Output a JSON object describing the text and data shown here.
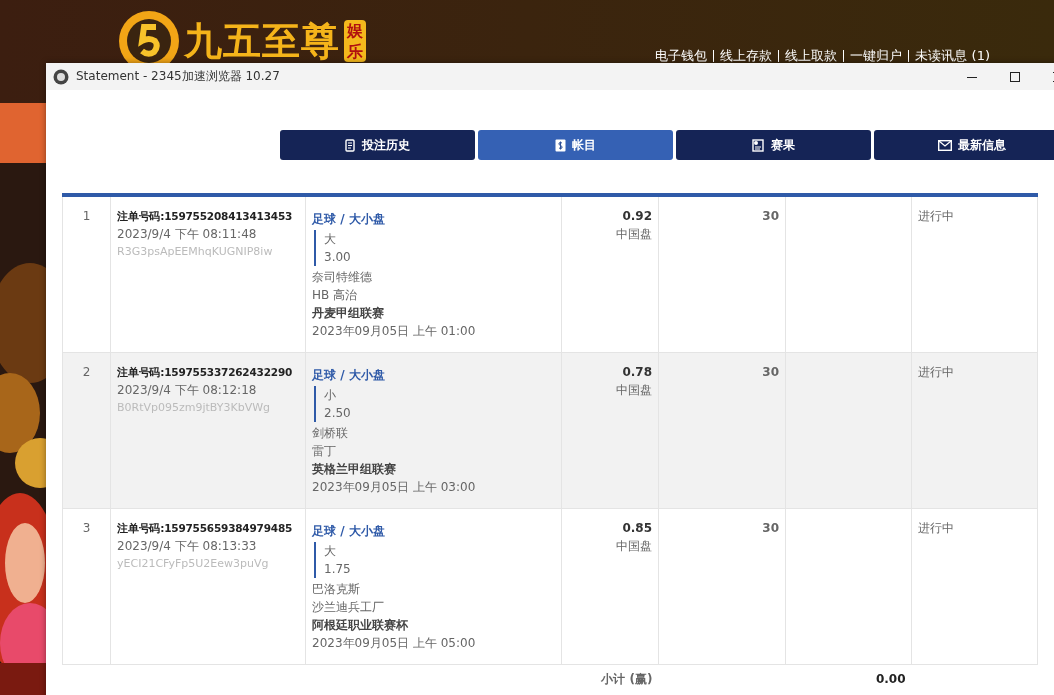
{
  "site": {
    "logo": "九五至尊",
    "logo_badge": "娱乐",
    "links": [
      "电子钱包",
      "线上存款",
      "线上取款",
      "一键归户",
      "未读讯息 (1)"
    ]
  },
  "window": {
    "title": "Statement - 2345加速浏览器 10.27"
  },
  "tabs": [
    {
      "label": "投注历史",
      "selected": false
    },
    {
      "label": "帐目",
      "selected": true
    },
    {
      "label": "赛果",
      "selected": false
    },
    {
      "label": "最新信息",
      "selected": false
    }
  ],
  "rows": [
    {
      "index": "1",
      "bet_no": "注单号码:159755208413413453",
      "time": "2023/9/4 下午 08:11:48",
      "code": "R3G3psApEEMhqKUGNIP8iw",
      "market": "足球 / 大小盘",
      "pick": "大",
      "line": "3.00",
      "home": "奈司特维德",
      "away": "HB 高治",
      "league": "丹麦甲组联赛",
      "match_time": "2023年09月05日 上午 01:00",
      "odds": "0.92",
      "odds_type": "中国盘",
      "stake": "30",
      "status": "进行中"
    },
    {
      "index": "2",
      "bet_no": "注单号码:159755337262432290",
      "time": "2023/9/4 下午 08:12:18",
      "code": "B0RtVp095zm9jtBY3KbVWg",
      "market": "足球 / 大小盘",
      "pick": "小",
      "line": "2.50",
      "home": "剑桥联",
      "away": "雷丁",
      "league": "英格兰甲组联赛",
      "match_time": "2023年09月05日 上午 03:00",
      "odds": "0.78",
      "odds_type": "中国盘",
      "stake": "30",
      "status": "进行中"
    },
    {
      "index": "3",
      "bet_no": "注单号码:159755659384979485",
      "time": "2023/9/4 下午 08:13:33",
      "code": "yECI21CFyFp5U2Eew3puVg",
      "market": "足球 / 大小盘",
      "pick": "大",
      "line": "1.75",
      "home": "巴洛克斯",
      "away": "沙兰迪兵工厂",
      "league": "阿根廷职业联赛杯",
      "match_time": "2023年09月05日 上午 05:00",
      "odds": "0.85",
      "odds_type": "中国盘",
      "stake": "30",
      "status": "进行中"
    }
  ],
  "subtotal": {
    "label": "小计 (赢)",
    "value": "0.00"
  }
}
